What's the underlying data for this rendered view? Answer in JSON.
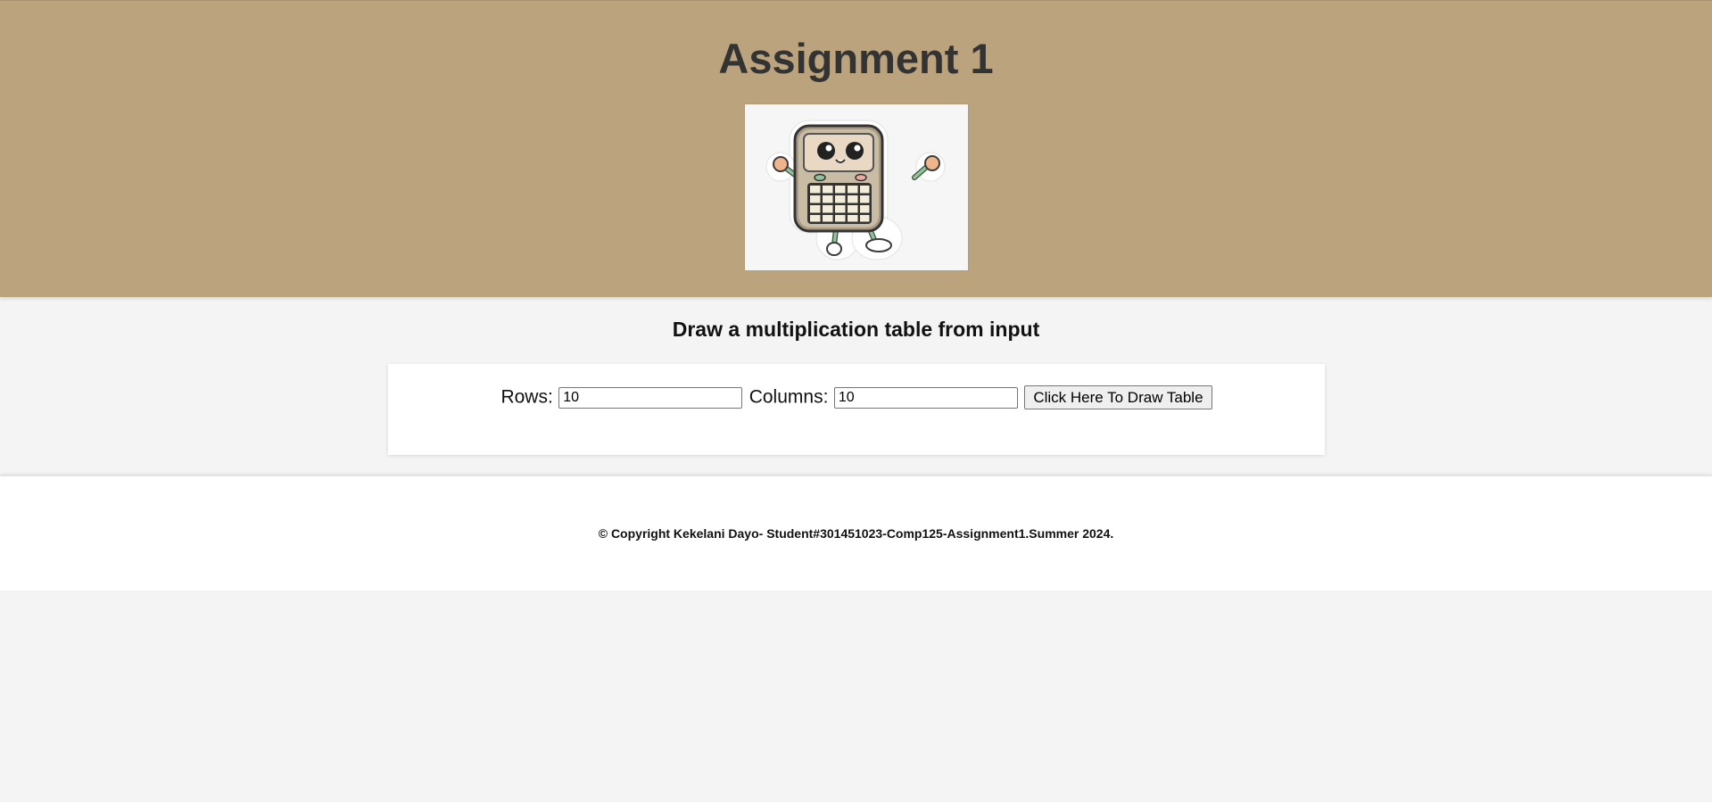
{
  "header": {
    "title": "Assignment 1",
    "logo_icon": "calculator-mascot-icon",
    "background_color": "#bba37e"
  },
  "main": {
    "subtitle": "Draw a multiplication table from input",
    "form": {
      "rows_label": "Rows:",
      "rows_value": "10",
      "columns_label": "Columns:",
      "columns_value": "10",
      "draw_button_label": "Click Here To Draw Table"
    }
  },
  "footer": {
    "copyright": "© Copyright Kekelani Dayo- Student#301451023-Comp125-Assignment1.Summer 2024."
  }
}
